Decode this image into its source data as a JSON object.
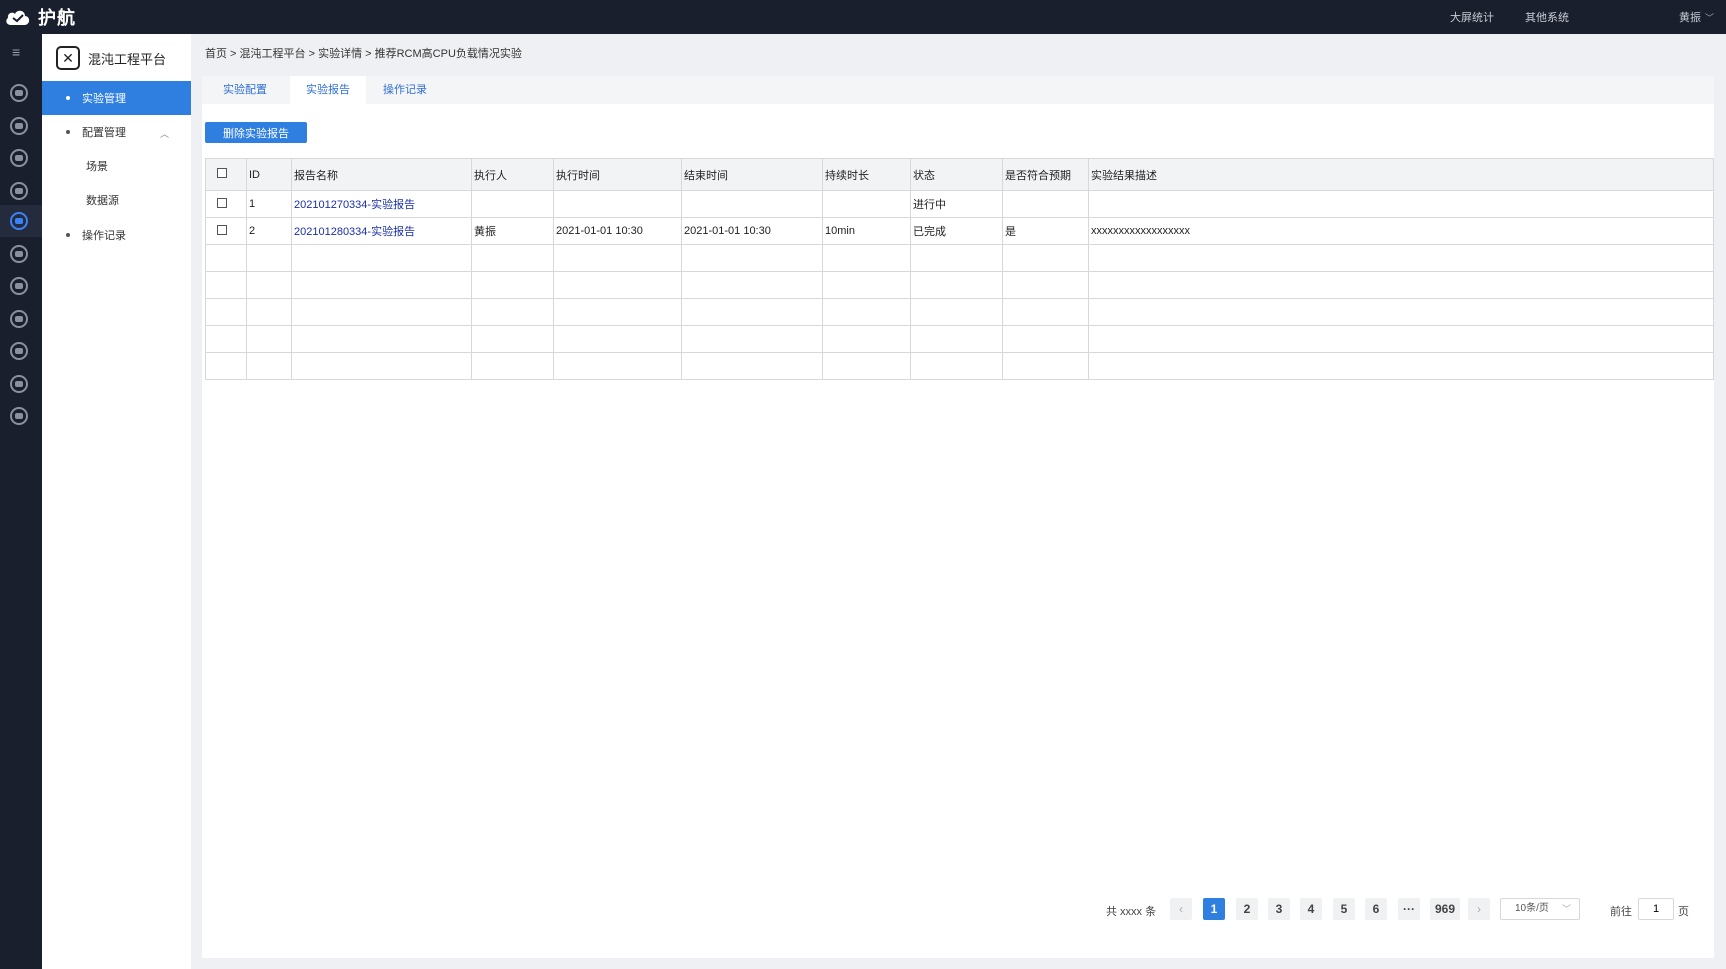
{
  "topbar": {
    "logo_text": "护航",
    "links": [
      "大屏统计",
      "其他系统"
    ],
    "user": "黄振"
  },
  "sidebar": {
    "brand_name": "混沌工程平台",
    "items": [
      {
        "label": "实验管理"
      },
      {
        "label": "配置管理"
      },
      {
        "label": "场景"
      },
      {
        "label": "数据源"
      },
      {
        "label": "操作记录"
      }
    ]
  },
  "breadcrumb": "首页 > 混沌工程平台 > 实验详情 > 推荐RCM高CPU负载情况实验",
  "tabs": [
    {
      "label": "实验配置"
    },
    {
      "label": "实验报告"
    },
    {
      "label": "操作记录"
    }
  ],
  "actions": {
    "delete_label": "删除实验报告"
  },
  "table": {
    "headers": [
      "ID",
      "报告名称",
      "执行人",
      "执行时间",
      "结束时间",
      "持续时长",
      "状态",
      "是否符合预期",
      "实验结果描述"
    ],
    "rows": [
      {
        "id": "1",
        "name": "202101270334-实验报告",
        "executor": "",
        "start": "",
        "end": "",
        "duration": "",
        "status": "进行中",
        "expected": "",
        "desc": ""
      },
      {
        "id": "2",
        "name": "202101280334-实验报告",
        "executor": "黄振",
        "start": "2021-01-01 10:30",
        "end": "2021-01-01 10:30",
        "duration": "10min",
        "status": "已完成",
        "expected": "是",
        "desc": "xxxxxxxxxxxxxxxxxx"
      }
    ]
  },
  "pagination": {
    "total_text": "共 xxxx 条",
    "prev": "‹",
    "next": "›",
    "pages": [
      "1",
      "2",
      "3",
      "4",
      "5",
      "6",
      "···",
      "969"
    ],
    "page_size": "10条/页",
    "goto_label": "前往",
    "goto_value": "1",
    "goto_suffix": "页"
  }
}
